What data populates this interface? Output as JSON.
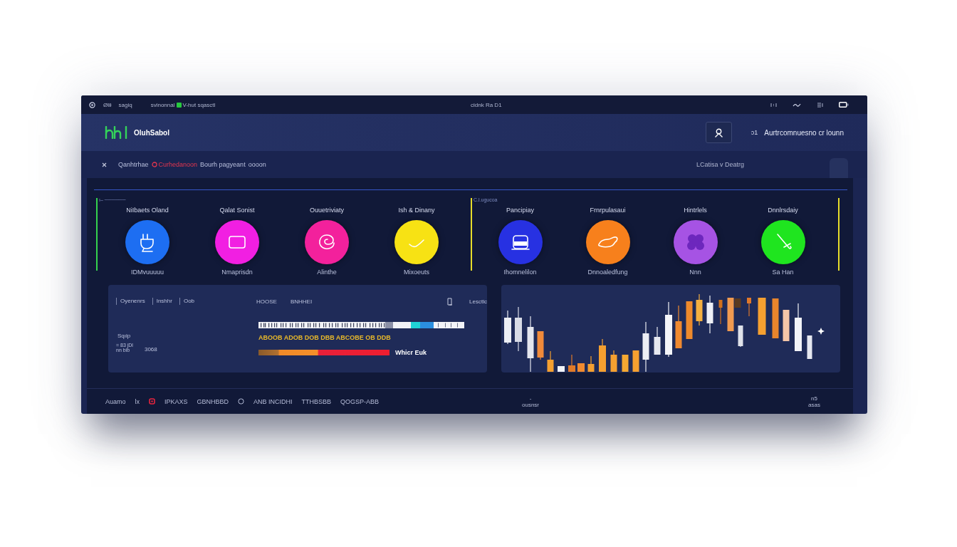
{
  "top_bar": {
    "items": [
      "Ølił",
      "sagiq",
      "svinonnal"
    ],
    "status": "V-hut sqasctl",
    "center": "cidnk Ra D1"
  },
  "header": {
    "app_name": "OluhSabol",
    "account_code": "ɔ1",
    "account_label": "Aurtrcomnuesno cr lounn"
  },
  "breadcrumb": {
    "items": [
      {
        "label": "Qanhtrhae",
        "kind": "plain"
      },
      {
        "label": "Curhedanoon",
        "kind": "alert"
      },
      {
        "label": "Bourh pagyeant",
        "kind": "plain"
      },
      {
        "label": "oooon",
        "kind": "plain"
      }
    ],
    "right_text": "LCatisa v Deatrg"
  },
  "categories": {
    "groups": [
      {
        "label": "ı– ──────",
        "color": "#35d24e",
        "items": [
          {
            "title": "NiIbaets Oland",
            "caption": "IDMvuuuuu",
            "color": "#1d6ef2"
          },
          {
            "title": "Qalat Sonist",
            "caption": "Nmaprisdn",
            "color": "#f11fe2"
          },
          {
            "title": "Ouuetriviaty",
            "caption": "Alinthe",
            "color": "#f3219c"
          },
          {
            "title": "Ish & Dinany",
            "caption": "Mixoeuts",
            "color": "#f7e214"
          }
        ]
      },
      {
        "label": "C.l.ugucoa",
        "color": "#e6dc2a",
        "items": [
          {
            "title": "Pancipiay",
            "caption": "Ihomnelilon",
            "color": "#2731e2"
          },
          {
            "title": "Frnrpulasaui",
            "caption": "Dnnoaledfung",
            "color": "#f7801c"
          },
          {
            "title": "Hintrlels",
            "caption": "Nnn",
            "color": "#a653e4"
          },
          {
            "title": "Dnnlrsdaiy",
            "caption": "Sa Han",
            "color": "#1fe51f"
          }
        ]
      }
    ]
  },
  "stats_panel": {
    "header_items": [
      "Oyenenrs",
      "Inshhr",
      "Oob"
    ],
    "columns": [
      "HOOSE",
      "BNHHEI"
    ],
    "action": "Lesctlc",
    "label": "Sqıip",
    "small_lines": [
      "= 83 jDl",
      "nn bib"
    ],
    "value": "3068",
    "bar_caption": "ABOOB ADOB DOB DBB ABCOBE OB DDB",
    "meter": {
      "level": 1,
      "reading": "Whicr Euk"
    }
  },
  "footer": {
    "items": [
      {
        "kind": "text",
        "label": "Auamo"
      },
      {
        "kind": "text",
        "label": "lx"
      },
      {
        "kind": "square"
      },
      {
        "kind": "text",
        "label": "IPKAXS"
      },
      {
        "kind": "text",
        "label": "GBNHBBD"
      },
      {
        "kind": "circle"
      },
      {
        "kind": "text",
        "label": "ANB INCIDHI"
      },
      {
        "kind": "text",
        "label": "TTHBSBB"
      },
      {
        "kind": "text",
        "label": "QOGSP-ABB"
      }
    ],
    "center": {
      "mark": "-",
      "label": "ousnsr"
    },
    "right": {
      "mark": "n5",
      "label": "asas"
    }
  }
}
